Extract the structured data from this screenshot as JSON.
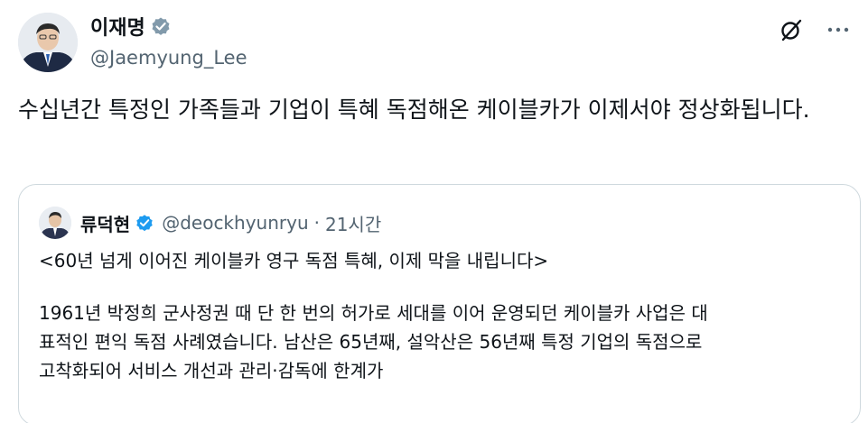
{
  "author": {
    "name": "이재명",
    "handle": "@Jaemyung_Lee",
    "avatar_icon": "person-avatar-icon",
    "verified_icon": "verified-badge-icon",
    "verified_color": "#829aab"
  },
  "actions": {
    "grok_icon": "grok-icon",
    "more_icon": "more-icon"
  },
  "tweet": {
    "text": "수십년간 특정인 가족들과 기업이 특혜 독점해온 케이블카가 이제서야 정상화됩니다."
  },
  "quote": {
    "name": "류덕현",
    "handle": "@deockhyunryu",
    "separator": "·",
    "time": "21시간",
    "verified_color": "#1d9bf0",
    "title_line": "<60년 넘게 이어진 케이블카 영구 독점 특혜, 이제 막을 내립니다>",
    "body_lines": [
      "1961년 박정희 군사정권 때 단 한 번의 허가로 세대를 이어 운영되던 케이블카 사업은 대",
      "표적인 편익 독점 사례였습니다. 남산은 65년째, 설악산은 56년째 특정 기업의 독점으로",
      "고착화되어 서비스 개선과 관리·감독에 한계가"
    ]
  },
  "colors": {
    "text": "#0f1419",
    "secondary": "#536471",
    "border": "#cfd9de"
  }
}
